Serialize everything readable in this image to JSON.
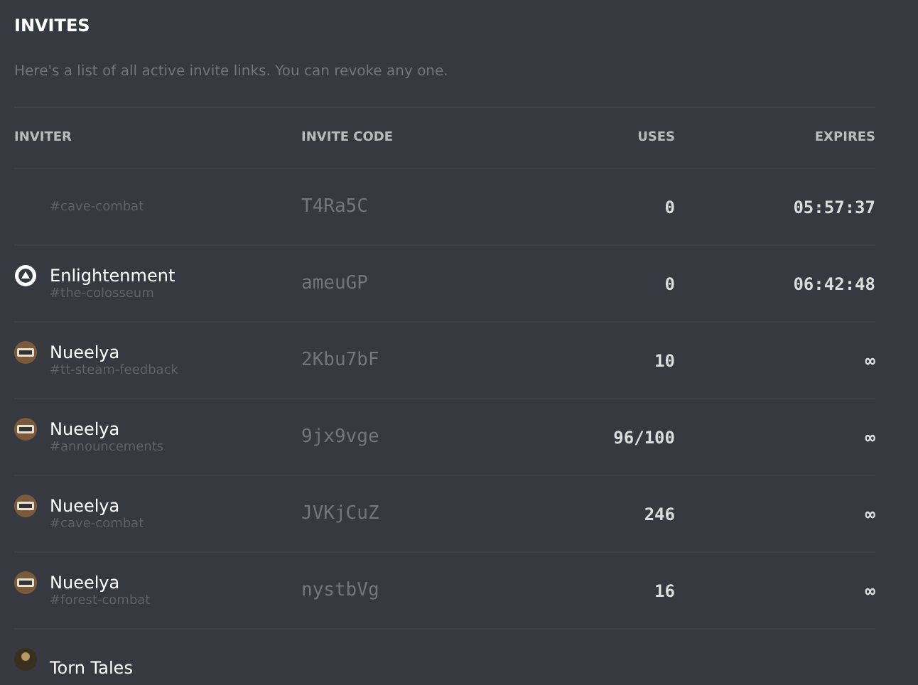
{
  "title": "INVITES",
  "description": "Here's a list of all active invite links. You can revoke any one.",
  "table": {
    "columns": [
      "INVITER",
      "INVITE CODE",
      "USES",
      "EXPIRES"
    ],
    "rows": [
      {
        "kind": "plain",
        "inviter": "",
        "channel": "#cave-combat",
        "code": "T4Ra5C",
        "uses": "0",
        "expires": "05:57:37"
      },
      {
        "kind": "logo",
        "inviter": "Enlightenment",
        "channel": "#the-colosseum",
        "code": "ameuGP",
        "uses": "0",
        "expires": "06:42:48"
      },
      {
        "kind": "badge",
        "inviter": "Nueelya",
        "channel": "#tt-steam-feedback",
        "code": "2Kbu7bF",
        "uses": "10",
        "expires": "∞"
      },
      {
        "kind": "badge",
        "inviter": "Nueelya",
        "channel": "#announcements",
        "code": "9jx9vge",
        "uses": "96/100",
        "expires": "∞"
      },
      {
        "kind": "badge",
        "inviter": "Nueelya",
        "channel": "#cave-combat",
        "code": "JVKjCuZ",
        "uses": "246",
        "expires": "∞"
      },
      {
        "kind": "badge",
        "inviter": "Nueelya",
        "channel": "#forest-combat",
        "code": "nystbVg",
        "uses": "16",
        "expires": "∞"
      },
      {
        "kind": "figure",
        "inviter": "Torn Tales",
        "channel": "",
        "code": "",
        "uses": "",
        "expires": ""
      }
    ]
  }
}
